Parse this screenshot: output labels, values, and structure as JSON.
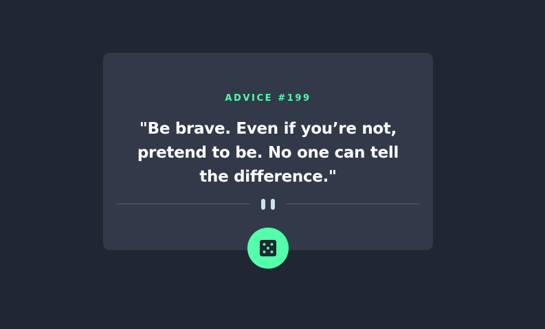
{
  "advice": {
    "number_label": "ADVICE #199",
    "quote": "\"Be brave. Even if you’re not, pretend to be. No one can tell the difference.\""
  },
  "icons": {
    "divider": "pause-icon",
    "button": "dice-icon"
  },
  "colors": {
    "background": "#202632",
    "card": "#323a49",
    "accent": "#53ffaa",
    "text": "#ffffff",
    "divider_line": "#4f5d74",
    "pause_bars": "#cee3e9"
  }
}
